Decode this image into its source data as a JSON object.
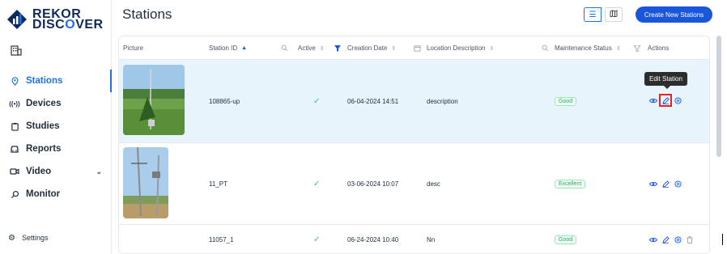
{
  "brand": {
    "line1": "REKOR",
    "line2_a": "DISC",
    "line2_o": "O",
    "line2_b": "VER"
  },
  "sidebar": {
    "items": [
      {
        "label": "Stations",
        "icon": "location-pin-icon",
        "active": true
      },
      {
        "label": "Devices",
        "icon": "signal-icon"
      },
      {
        "label": "Studies",
        "icon": "clipboard-icon"
      },
      {
        "label": "Reports",
        "icon": "car-icon"
      },
      {
        "label": "Video",
        "icon": "video-icon",
        "expandable": true
      },
      {
        "label": "Monitor",
        "icon": "search-icon"
      }
    ],
    "settings_label": "Settings"
  },
  "header": {
    "title": "Stations",
    "create_button": "Create New Stations"
  },
  "table": {
    "columns": {
      "picture": "Picture",
      "station_id": "Station ID",
      "active": "Active",
      "creation_date": "Creation Date",
      "location": "Location Description",
      "maintenance": "Maintenance Status",
      "actions": "Actions"
    },
    "rows": [
      {
        "station_id": "108865-up",
        "date": "06-04-2024 14:51",
        "location": "description",
        "status": "Good"
      },
      {
        "station_id": "11_PT",
        "date": "03-06-2024 10:07",
        "location": "desc",
        "status": "Excellent"
      },
      {
        "station_id": "11057_1",
        "date": "06-24-2024 10:40",
        "location": "Nn",
        "status": "Good"
      }
    ]
  },
  "tooltip": "Edit Station",
  "colors": {
    "accent": "#1a56db",
    "selected_row": "#e8f4fc",
    "status_green": "#38a169",
    "highlight": "#e02424"
  }
}
